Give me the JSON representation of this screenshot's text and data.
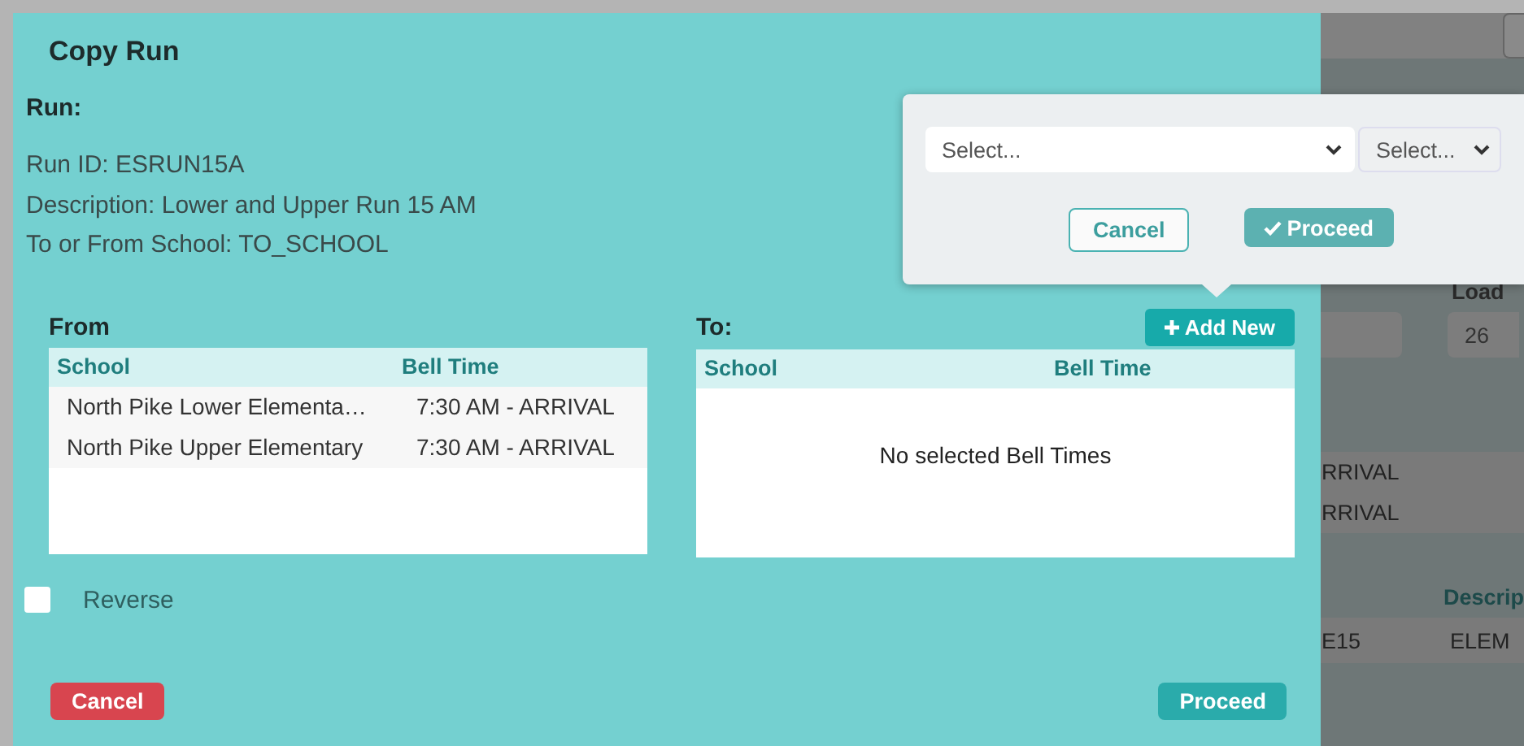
{
  "dialog": {
    "title": "Copy Run",
    "section_label": "Run:",
    "details": [
      "Run ID: ESRUN15A",
      "Description: Lower and Upper Run 15 AM",
      "To or From School: TO_SCHOOL"
    ],
    "from": {
      "label": "From",
      "columns": [
        "School",
        "Bell Time"
      ],
      "rows": [
        {
          "school": "North Pike Lower Elementa…",
          "bell_time": "7:30 AM - ARRIVAL"
        },
        {
          "school": "North Pike Upper Elementary",
          "bell_time": "7:30 AM - ARRIVAL"
        }
      ]
    },
    "to": {
      "label": "To:",
      "add_button": "Add New",
      "columns": [
        "School",
        "Bell Time"
      ],
      "empty_message": "No selected Bell Times"
    },
    "reverse": {
      "label": "Reverse",
      "checked": false
    },
    "cancel_button": "Cancel",
    "proceed_button": "Proceed"
  },
  "popover": {
    "school_select": {
      "placeholder": "Select..."
    },
    "time_select": {
      "placeholder": "Select..."
    },
    "cancel_button": "Cancel",
    "proceed_button": "Proceed"
  },
  "background_page": {
    "load_label": "Load",
    "load_value": "26",
    "cells": [
      "RRIVAL",
      "RRIVAL"
    ],
    "column_heading": "Descrip",
    "row": [
      "E15",
      "ELEM"
    ]
  }
}
